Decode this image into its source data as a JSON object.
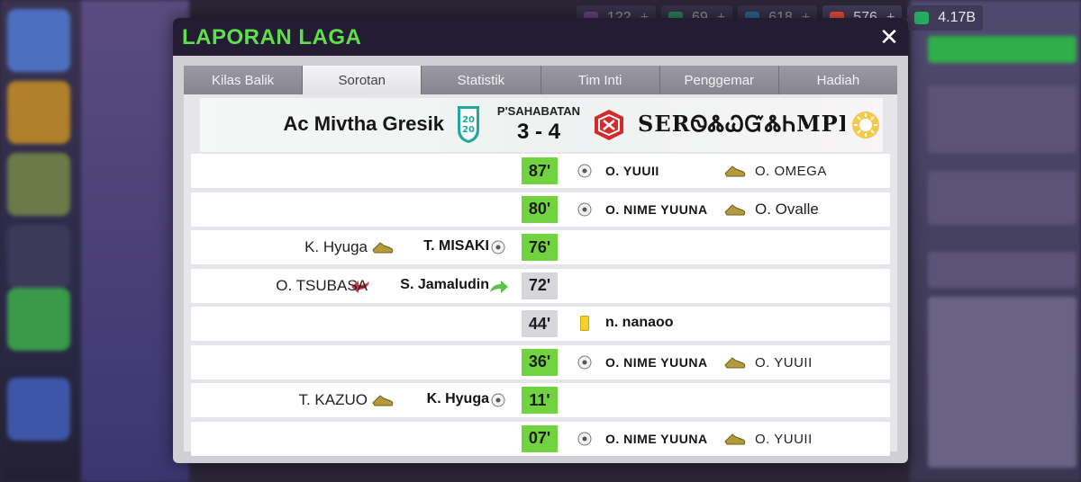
{
  "topbar": {
    "resources": [
      {
        "name": "tokens",
        "value": "122",
        "color": "#9b59b6"
      },
      {
        "name": "energy",
        "value": "69",
        "color": "#2ecc71"
      },
      {
        "name": "scouts",
        "value": "618",
        "color": "#3498db"
      },
      {
        "name": "medical",
        "value": "576",
        "color": "#e74c3c"
      },
      {
        "name": "money",
        "value": "4.17B",
        "color": "#27ae60"
      }
    ],
    "plus_label": "+"
  },
  "modal": {
    "title": "LAPORAN LAGA",
    "close_label": "✕",
    "tabs": [
      {
        "label": "Kilas Balik",
        "active": false
      },
      {
        "label": "Sorotan",
        "active": true
      },
      {
        "label": "Statistik",
        "active": false
      },
      {
        "label": "Tim Inti",
        "active": false
      },
      {
        "label": "Penggemar",
        "active": false
      },
      {
        "label": "Hadiah",
        "active": false
      }
    ]
  },
  "match": {
    "home_team": "Ac Mivtha Gresik",
    "away_team": "SERᏫᏜᏇᏳᏜᏂMPE…",
    "match_type": "P'SAHABATAN",
    "score": "3 - 4",
    "home_badge_text": "20\n20",
    "home_badge_color": "#1fa7a0",
    "away_badge_color": "#d42a2a"
  },
  "events": [
    {
      "minute": "87'",
      "side": "away",
      "type": "goal",
      "scorer": "O. YUUII",
      "assist": "O. OMEGA",
      "caps": false
    },
    {
      "minute": "80'",
      "side": "away",
      "type": "goal",
      "scorer": "O. NIME YUUNA",
      "assist": "O. Ovalle",
      "caps": false
    },
    {
      "minute": "76'",
      "side": "home",
      "type": "goal",
      "scorer": "T. MISAKI",
      "assist": "K. Hyuga",
      "caps": false
    },
    {
      "minute": "72'",
      "side": "home",
      "type": "sub",
      "scorer": "S. Jamaludin",
      "assist": "O. TSUBASA",
      "caps": false
    },
    {
      "minute": "44'",
      "side": "away",
      "type": "card",
      "scorer": "n. nanaoo",
      "assist": "",
      "caps": false
    },
    {
      "minute": "36'",
      "side": "away",
      "type": "goal",
      "scorer": "O. NIME YUUNA",
      "assist": "O. YUUII",
      "caps": false
    },
    {
      "minute": "11'",
      "side": "home",
      "type": "goal",
      "scorer": "K. Hyuga",
      "assist": "T. KAZUO",
      "caps": false
    },
    {
      "minute": "07'",
      "side": "away",
      "type": "goal",
      "scorer": "O. NIME YUUNA",
      "assist": "O. YUUII",
      "caps": false
    }
  ],
  "colors": {
    "title_green": "#5fe04a",
    "minute_goal": "#72d341",
    "minute_grey": "#d7d7db",
    "header_bg": "#231c33"
  }
}
